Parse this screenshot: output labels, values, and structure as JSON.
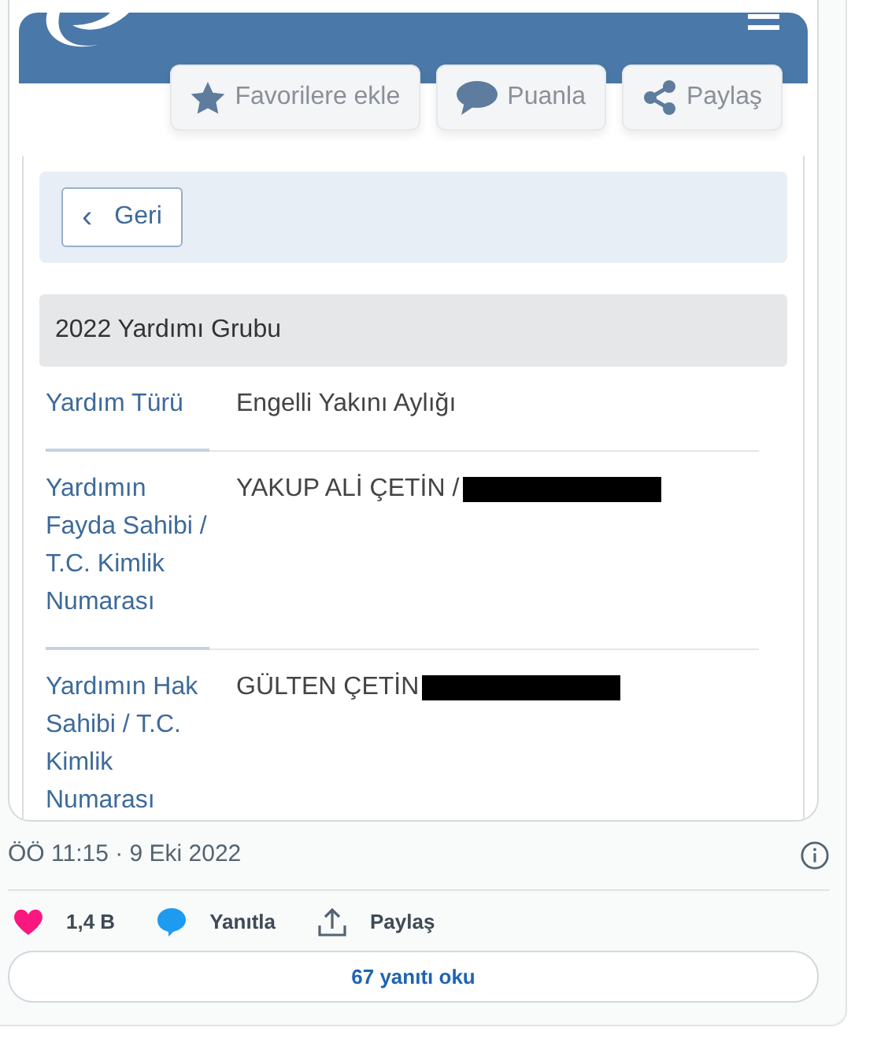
{
  "embedded_page": {
    "toolbar_buttons": [
      {
        "kind": "star",
        "label": "Favorilere ekle"
      },
      {
        "kind": "comment",
        "label": "Puanla"
      },
      {
        "kind": "share",
        "label": "Paylaş"
      }
    ],
    "back_button": {
      "icon": "‹",
      "label": "Geri"
    },
    "group_title": "2022 Yardımı Grubu",
    "rows": [
      {
        "label": "Yardım Türü",
        "value": "Engelli Yakını Aylığı",
        "redacted": false
      },
      {
        "label": "Yardımın Fayda Sahibi / T.C. Kimlik Numarası",
        "value": "YAKUP ALİ ÇETİN /",
        "redacted": true
      },
      {
        "label": "Yardımın Hak Sahibi / T.C. Kimlik Numarası",
        "value": "GÜLTEN ÇETİN",
        "redacted": true
      }
    ]
  },
  "tweet": {
    "timestamp": "ÖÖ 11:15 · 9 Eki 2022",
    "actions": [
      {
        "kind": "like",
        "label": "1,4 B"
      },
      {
        "kind": "reply",
        "label": "Yanıtla"
      },
      {
        "kind": "share",
        "label": "Paylaş"
      }
    ],
    "read_replies": "67 yanıtı oku"
  }
}
